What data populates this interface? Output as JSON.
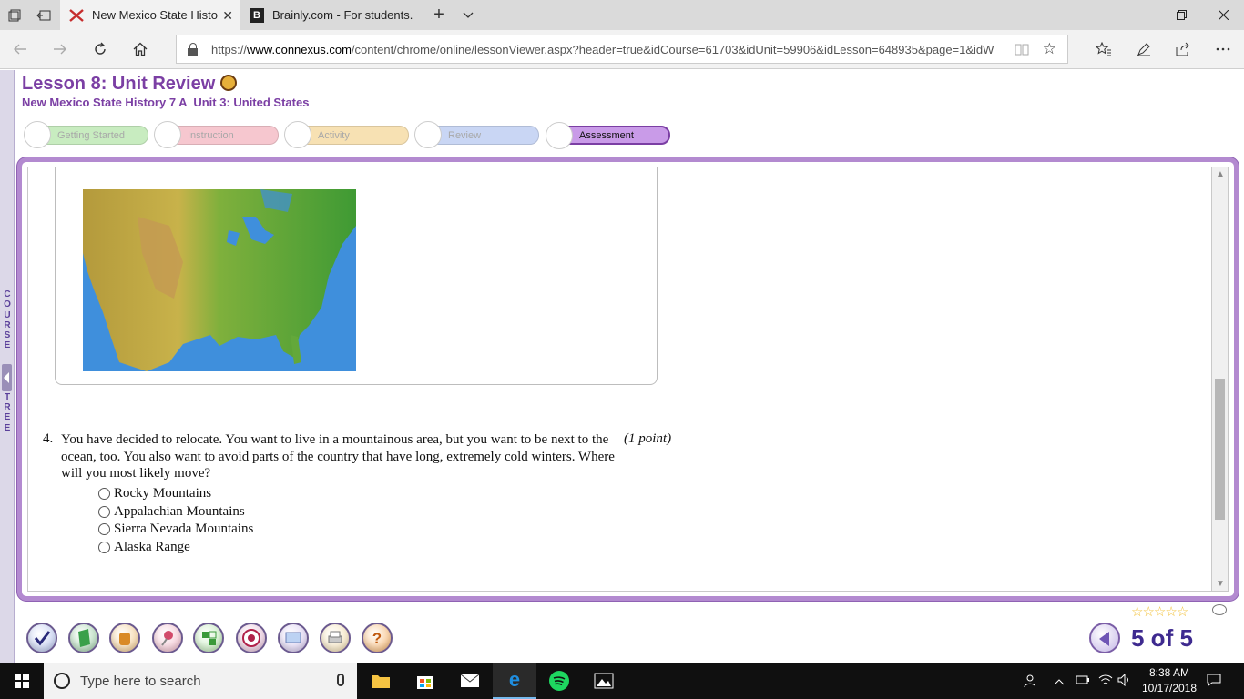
{
  "browser": {
    "tabs": [
      {
        "title": "New Mexico State Histo",
        "favicon": "connexus-icon",
        "active": true
      },
      {
        "title": "Brainly.com - For students.",
        "favicon": "brainly-icon",
        "active": false
      }
    ],
    "new_tab_label": "+",
    "tab_list_label": "⌄",
    "url": "https://www.connexus.com/content/chrome/online/lessonViewer.aspx?header=true&idCourse=61703&idUnit=59906&idLesson=648935&page=1&idW",
    "url_host": "www.connexus.com",
    "url_prefix": "https://",
    "url_rest": "/content/chrome/online/lessonViewer.aspx?header=true&idCourse=61703&idUnit=59906&idLesson=648935&page=1&idW"
  },
  "lesson": {
    "title": "Lesson 8: Unit Review",
    "subtitle": "New Mexico State History 7 A  Unit 3: United States",
    "steps": [
      {
        "label": "Getting Started",
        "color": "#c8ecc0",
        "active": false
      },
      {
        "label": "Instruction",
        "color": "#f6c7cf",
        "active": false
      },
      {
        "label": "Activity",
        "color": "#f7e1b3",
        "active": false
      },
      {
        "label": "Review",
        "color": "#c9d6f4",
        "active": false
      },
      {
        "label": "Assessment",
        "color": "#c99be8",
        "active": true
      }
    ]
  },
  "course_tree_letters": [
    "C",
    "O",
    "U",
    "R",
    "S",
    "E",
    "",
    "T",
    "R",
    "E",
    "E"
  ],
  "question": {
    "number": "4.",
    "text": "You have decided to relocate. You want to live in a mountainous area, but you want to be next to the ocean, too. You also want to avoid parts of the country that have long, extremely cold winters. Where will you most likely move?",
    "points": "(1 point)",
    "options": [
      "Rocky Mountains",
      "Appalachian Mountains",
      "Sierra Nevada Mountains",
      "Alaska Range"
    ],
    "map_image": "north-america-relief-map"
  },
  "rating": {
    "stars": "☆☆☆☆☆"
  },
  "toolbar": {
    "tools": [
      "check-icon",
      "book-icon",
      "backpack-icon",
      "pin-icon",
      "puzzle-icon",
      "target-icon",
      "monitor-icon",
      "printer-icon",
      "help-icon"
    ]
  },
  "pager": {
    "label": "5 of 5"
  },
  "taskbar": {
    "search_placeholder": "Type here to search",
    "time": "8:38 AM",
    "date": "10/17/2018"
  },
  "colors": {
    "brand_purple": "#7b3fa4",
    "frame_purple": "#b38ad0",
    "pager_blue": "#3e2a8f"
  }
}
